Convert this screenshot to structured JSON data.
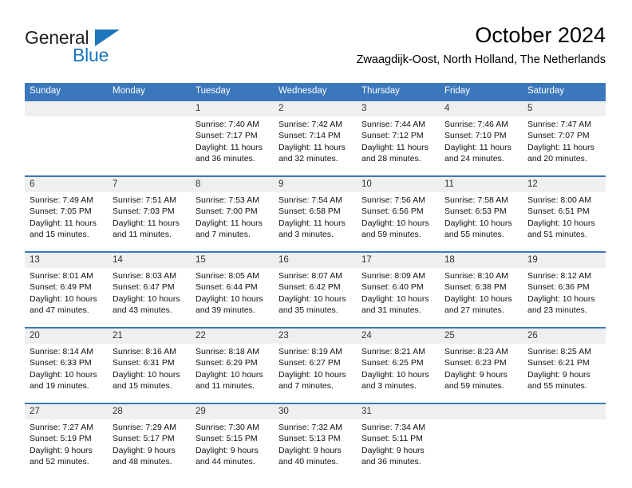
{
  "logo": {
    "word_one": "General",
    "word_two": "Blue",
    "triangle_color": "#1b76bc",
    "icon": "general-blue-logo"
  },
  "header": {
    "title": "October 2024",
    "subtitle": "Zwaagdijk-Oost, North Holland, The Netherlands"
  },
  "colors": {
    "header_blue": "#3b77bb",
    "daynum_band": "#efefef",
    "brand_blue": "#1b76bc",
    "text": "#111111"
  },
  "weekdays": [
    "Sunday",
    "Monday",
    "Tuesday",
    "Wednesday",
    "Thursday",
    "Friday",
    "Saturday"
  ],
  "weeks": [
    {
      "days": [
        {
          "num": "",
          "sunrise": "",
          "sunset": "",
          "daylight_a": "",
          "daylight_b": ""
        },
        {
          "num": "",
          "sunrise": "",
          "sunset": "",
          "daylight_a": "",
          "daylight_b": ""
        },
        {
          "num": "1",
          "sunrise": "Sunrise: 7:40 AM",
          "sunset": "Sunset: 7:17 PM",
          "daylight_a": "Daylight: 11 hours",
          "daylight_b": "and 36 minutes."
        },
        {
          "num": "2",
          "sunrise": "Sunrise: 7:42 AM",
          "sunset": "Sunset: 7:14 PM",
          "daylight_a": "Daylight: 11 hours",
          "daylight_b": "and 32 minutes."
        },
        {
          "num": "3",
          "sunrise": "Sunrise: 7:44 AM",
          "sunset": "Sunset: 7:12 PM",
          "daylight_a": "Daylight: 11 hours",
          "daylight_b": "and 28 minutes."
        },
        {
          "num": "4",
          "sunrise": "Sunrise: 7:46 AM",
          "sunset": "Sunset: 7:10 PM",
          "daylight_a": "Daylight: 11 hours",
          "daylight_b": "and 24 minutes."
        },
        {
          "num": "5",
          "sunrise": "Sunrise: 7:47 AM",
          "sunset": "Sunset: 7:07 PM",
          "daylight_a": "Daylight: 11 hours",
          "daylight_b": "and 20 minutes."
        }
      ]
    },
    {
      "days": [
        {
          "num": "6",
          "sunrise": "Sunrise: 7:49 AM",
          "sunset": "Sunset: 7:05 PM",
          "daylight_a": "Daylight: 11 hours",
          "daylight_b": "and 15 minutes."
        },
        {
          "num": "7",
          "sunrise": "Sunrise: 7:51 AM",
          "sunset": "Sunset: 7:03 PM",
          "daylight_a": "Daylight: 11 hours",
          "daylight_b": "and 11 minutes."
        },
        {
          "num": "8",
          "sunrise": "Sunrise: 7:53 AM",
          "sunset": "Sunset: 7:00 PM",
          "daylight_a": "Daylight: 11 hours",
          "daylight_b": "and 7 minutes."
        },
        {
          "num": "9",
          "sunrise": "Sunrise: 7:54 AM",
          "sunset": "Sunset: 6:58 PM",
          "daylight_a": "Daylight: 11 hours",
          "daylight_b": "and 3 minutes."
        },
        {
          "num": "10",
          "sunrise": "Sunrise: 7:56 AM",
          "sunset": "Sunset: 6:56 PM",
          "daylight_a": "Daylight: 10 hours",
          "daylight_b": "and 59 minutes."
        },
        {
          "num": "11",
          "sunrise": "Sunrise: 7:58 AM",
          "sunset": "Sunset: 6:53 PM",
          "daylight_a": "Daylight: 10 hours",
          "daylight_b": "and 55 minutes."
        },
        {
          "num": "12",
          "sunrise": "Sunrise: 8:00 AM",
          "sunset": "Sunset: 6:51 PM",
          "daylight_a": "Daylight: 10 hours",
          "daylight_b": "and 51 minutes."
        }
      ]
    },
    {
      "days": [
        {
          "num": "13",
          "sunrise": "Sunrise: 8:01 AM",
          "sunset": "Sunset: 6:49 PM",
          "daylight_a": "Daylight: 10 hours",
          "daylight_b": "and 47 minutes."
        },
        {
          "num": "14",
          "sunrise": "Sunrise: 8:03 AM",
          "sunset": "Sunset: 6:47 PM",
          "daylight_a": "Daylight: 10 hours",
          "daylight_b": "and 43 minutes."
        },
        {
          "num": "15",
          "sunrise": "Sunrise: 8:05 AM",
          "sunset": "Sunset: 6:44 PM",
          "daylight_a": "Daylight: 10 hours",
          "daylight_b": "and 39 minutes."
        },
        {
          "num": "16",
          "sunrise": "Sunrise: 8:07 AM",
          "sunset": "Sunset: 6:42 PM",
          "daylight_a": "Daylight: 10 hours",
          "daylight_b": "and 35 minutes."
        },
        {
          "num": "17",
          "sunrise": "Sunrise: 8:09 AM",
          "sunset": "Sunset: 6:40 PM",
          "daylight_a": "Daylight: 10 hours",
          "daylight_b": "and 31 minutes."
        },
        {
          "num": "18",
          "sunrise": "Sunrise: 8:10 AM",
          "sunset": "Sunset: 6:38 PM",
          "daylight_a": "Daylight: 10 hours",
          "daylight_b": "and 27 minutes."
        },
        {
          "num": "19",
          "sunrise": "Sunrise: 8:12 AM",
          "sunset": "Sunset: 6:36 PM",
          "daylight_a": "Daylight: 10 hours",
          "daylight_b": "and 23 minutes."
        }
      ]
    },
    {
      "days": [
        {
          "num": "20",
          "sunrise": "Sunrise: 8:14 AM",
          "sunset": "Sunset: 6:33 PM",
          "daylight_a": "Daylight: 10 hours",
          "daylight_b": "and 19 minutes."
        },
        {
          "num": "21",
          "sunrise": "Sunrise: 8:16 AM",
          "sunset": "Sunset: 6:31 PM",
          "daylight_a": "Daylight: 10 hours",
          "daylight_b": "and 15 minutes."
        },
        {
          "num": "22",
          "sunrise": "Sunrise: 8:18 AM",
          "sunset": "Sunset: 6:29 PM",
          "daylight_a": "Daylight: 10 hours",
          "daylight_b": "and 11 minutes."
        },
        {
          "num": "23",
          "sunrise": "Sunrise: 8:19 AM",
          "sunset": "Sunset: 6:27 PM",
          "daylight_a": "Daylight: 10 hours",
          "daylight_b": "and 7 minutes."
        },
        {
          "num": "24",
          "sunrise": "Sunrise: 8:21 AM",
          "sunset": "Sunset: 6:25 PM",
          "daylight_a": "Daylight: 10 hours",
          "daylight_b": "and 3 minutes."
        },
        {
          "num": "25",
          "sunrise": "Sunrise: 8:23 AM",
          "sunset": "Sunset: 6:23 PM",
          "daylight_a": "Daylight: 9 hours",
          "daylight_b": "and 59 minutes."
        },
        {
          "num": "26",
          "sunrise": "Sunrise: 8:25 AM",
          "sunset": "Sunset: 6:21 PM",
          "daylight_a": "Daylight: 9 hours",
          "daylight_b": "and 55 minutes."
        }
      ]
    },
    {
      "days": [
        {
          "num": "27",
          "sunrise": "Sunrise: 7:27 AM",
          "sunset": "Sunset: 5:19 PM",
          "daylight_a": "Daylight: 9 hours",
          "daylight_b": "and 52 minutes."
        },
        {
          "num": "28",
          "sunrise": "Sunrise: 7:29 AM",
          "sunset": "Sunset: 5:17 PM",
          "daylight_a": "Daylight: 9 hours",
          "daylight_b": "and 48 minutes."
        },
        {
          "num": "29",
          "sunrise": "Sunrise: 7:30 AM",
          "sunset": "Sunset: 5:15 PM",
          "daylight_a": "Daylight: 9 hours",
          "daylight_b": "and 44 minutes."
        },
        {
          "num": "30",
          "sunrise": "Sunrise: 7:32 AM",
          "sunset": "Sunset: 5:13 PM",
          "daylight_a": "Daylight: 9 hours",
          "daylight_b": "and 40 minutes."
        },
        {
          "num": "31",
          "sunrise": "Sunrise: 7:34 AM",
          "sunset": "Sunset: 5:11 PM",
          "daylight_a": "Daylight: 9 hours",
          "daylight_b": "and 36 minutes."
        },
        {
          "num": "",
          "sunrise": "",
          "sunset": "",
          "daylight_a": "",
          "daylight_b": ""
        },
        {
          "num": "",
          "sunrise": "",
          "sunset": "",
          "daylight_a": "",
          "daylight_b": ""
        }
      ]
    }
  ]
}
